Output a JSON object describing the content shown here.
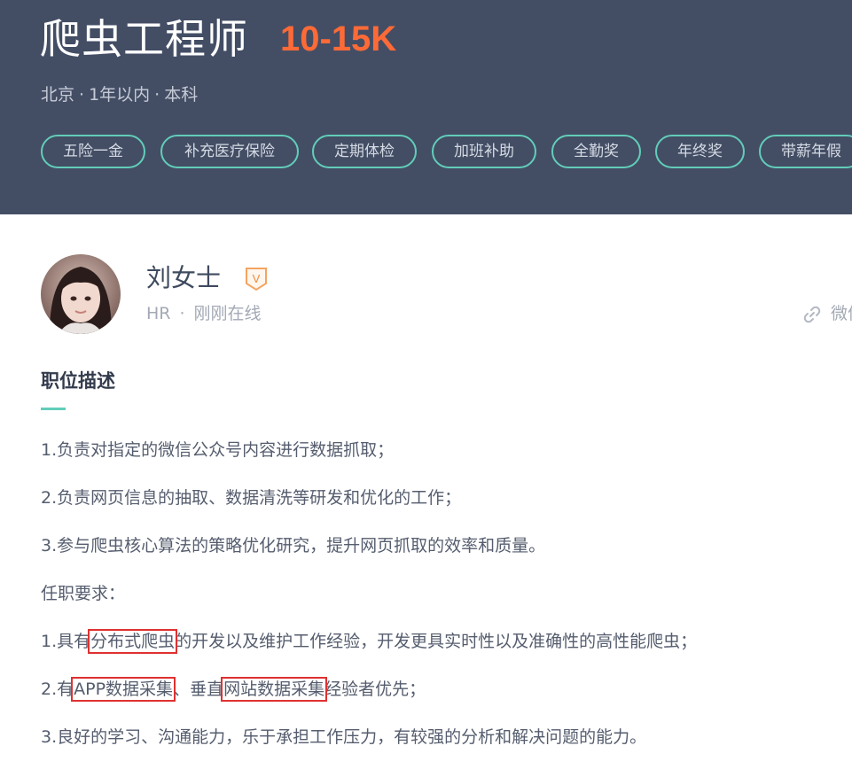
{
  "job": {
    "title": "爬虫工程师",
    "salary": "10-15K",
    "location": "北京",
    "experience": "1年以内",
    "education": "本科",
    "separator": "·",
    "benefits": [
      "五险一金",
      "补充医疗保险",
      "定期体检",
      "加班补助",
      "全勤奖",
      "年终奖",
      "带薪年假"
    ]
  },
  "recruiter": {
    "name": "刘女士",
    "verified_badge": "V",
    "role": "HR",
    "separator": "·",
    "status": "刚刚在线"
  },
  "share": {
    "label": "微信",
    "icon": "link-icon"
  },
  "description": {
    "title": "职位描述",
    "duties": [
      "1.负责对指定的微信公众号内容进行数据抓取；",
      "2.负责网页信息的抽取、数据清洗等研发和优化的工作；",
      "3.参与爬虫核心算法的策略优化研究，提升网页抓取的效率和质量。"
    ],
    "requirements_title": "任职要求：",
    "req1": {
      "pre": "1.具有",
      "hl": "分布式爬虫",
      "post": "的开发以及维护工作经验，开发更具实时性以及准确性的高性能爬虫；"
    },
    "req2": {
      "pre": "2.有",
      "hl1": "APP数据采集",
      "mid": "、垂直",
      "hl2": "网站数据采集",
      "post": "经验者优先；"
    },
    "req3": "3.良好的学习、沟通能力，乐于承担工作压力，有较强的分析和解决问题的能力。"
  },
  "colors": {
    "header_bg": "#434e65",
    "salary": "#fe6a36",
    "accent": "#62cdb9",
    "highlight_box": "#e03030",
    "verified_badge": "#f4a460"
  }
}
